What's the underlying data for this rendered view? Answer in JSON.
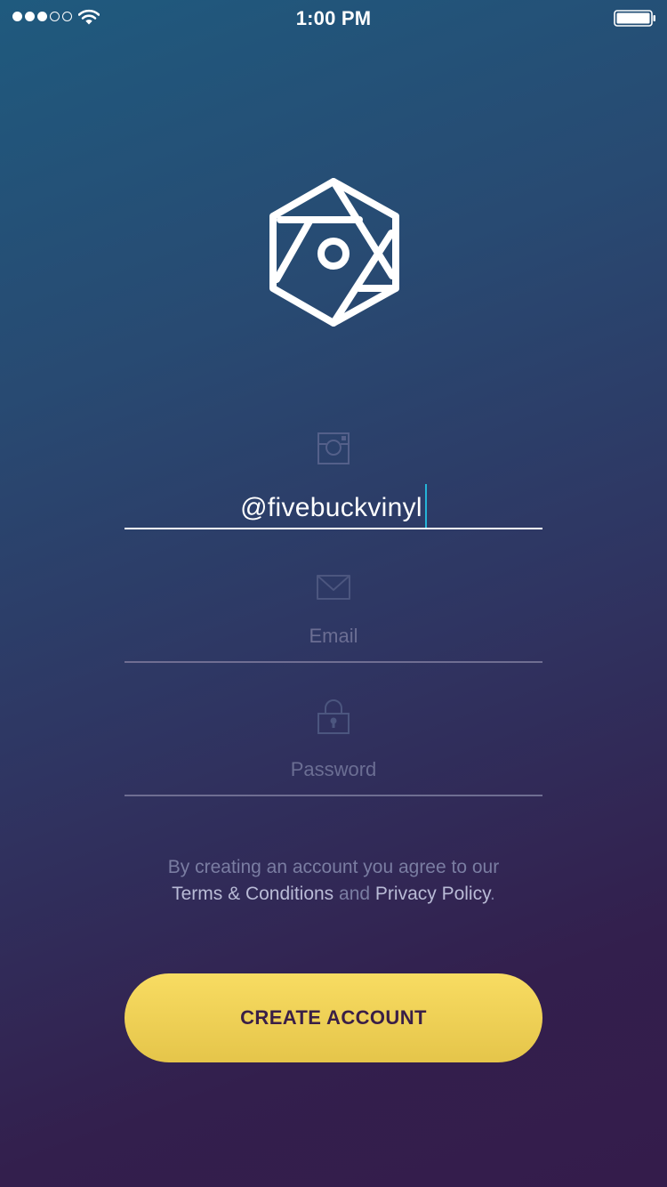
{
  "status_bar": {
    "time": "1:00 PM",
    "signal_bars_filled": 3,
    "signal_bars_total": 5,
    "icons": [
      "signal-dots-icon",
      "wifi-icon",
      "battery-icon"
    ]
  },
  "logo": {
    "icon": "hexagon-camera-logo-icon"
  },
  "form": {
    "instagram": {
      "icon": "instagram-icon",
      "value": "@fivebuckvinyl"
    },
    "email": {
      "icon": "envelope-icon",
      "placeholder": "Email"
    },
    "password": {
      "icon": "lock-icon",
      "placeholder": "Password"
    }
  },
  "terms": {
    "line1": "By creating an account you agree to our",
    "terms_link": "Terms & Conditions",
    "and": " and ",
    "privacy_link": "Privacy Policy",
    "period": "."
  },
  "create_button": {
    "label": "CREATE ACCOUNT"
  },
  "colors": {
    "gradient_top": "#1f5a7e",
    "gradient_bottom": "#341c4b",
    "button": "#f8dc62",
    "button_text": "#3a1f47",
    "caret": "#25b4d8"
  }
}
